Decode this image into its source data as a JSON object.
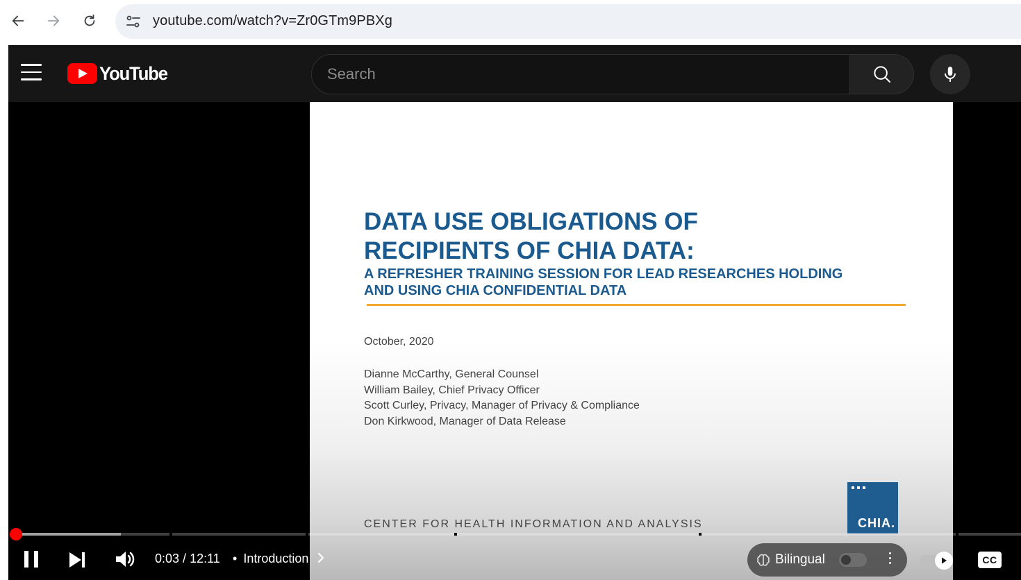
{
  "browser": {
    "url": "youtube.com/watch?v=Zr0GTm9PBXg",
    "back_icon": "arrow-left-icon",
    "forward_icon": "arrow-right-icon",
    "reload_icon": "reload-icon",
    "site_info_icon": "tune-icon"
  },
  "header": {
    "logo_text": "YouTube",
    "search_placeholder": "Search",
    "search_icon": "search-icon",
    "mic_icon": "mic-icon"
  },
  "slide": {
    "title_line1": "DATA USE OBLIGATIONS OF",
    "title_line2": "RECIPIENTS OF CHIA DATA:",
    "subtitle_line1": "A REFRESHER TRAINING SESSION FOR LEAD RESEARCHES HOLDING",
    "subtitle_line2": "AND USING CHIA CONFIDENTIAL DATA",
    "date": "October, 2020",
    "authors": [
      "Dianne McCarthy, General Counsel",
      "William Bailey, Chief Privacy Officer",
      "Scott Curley, Privacy, Manager of Privacy & Compliance",
      "Don Kirkwood, Manager of Data Release"
    ],
    "footer": "CENTER FOR HEALTH INFORMATION AND ANALYSIS",
    "logo_text": "CHIA.",
    "colors": {
      "title": "#1b5a8e",
      "rule": "#f0a830",
      "logo_bg": "#1f5c90"
    }
  },
  "player": {
    "current_time": "0:03",
    "separator": " / ",
    "duration": "12:11",
    "chapter_bullet": "•",
    "chapter": "Introduction",
    "progress_fraction": 0.004,
    "buffered_fraction": 0.106,
    "bilingual_label": "Bilingual",
    "bilingual_on": false,
    "autoplay_on": true,
    "cc_label": "CC",
    "accent": "#ff0000"
  }
}
